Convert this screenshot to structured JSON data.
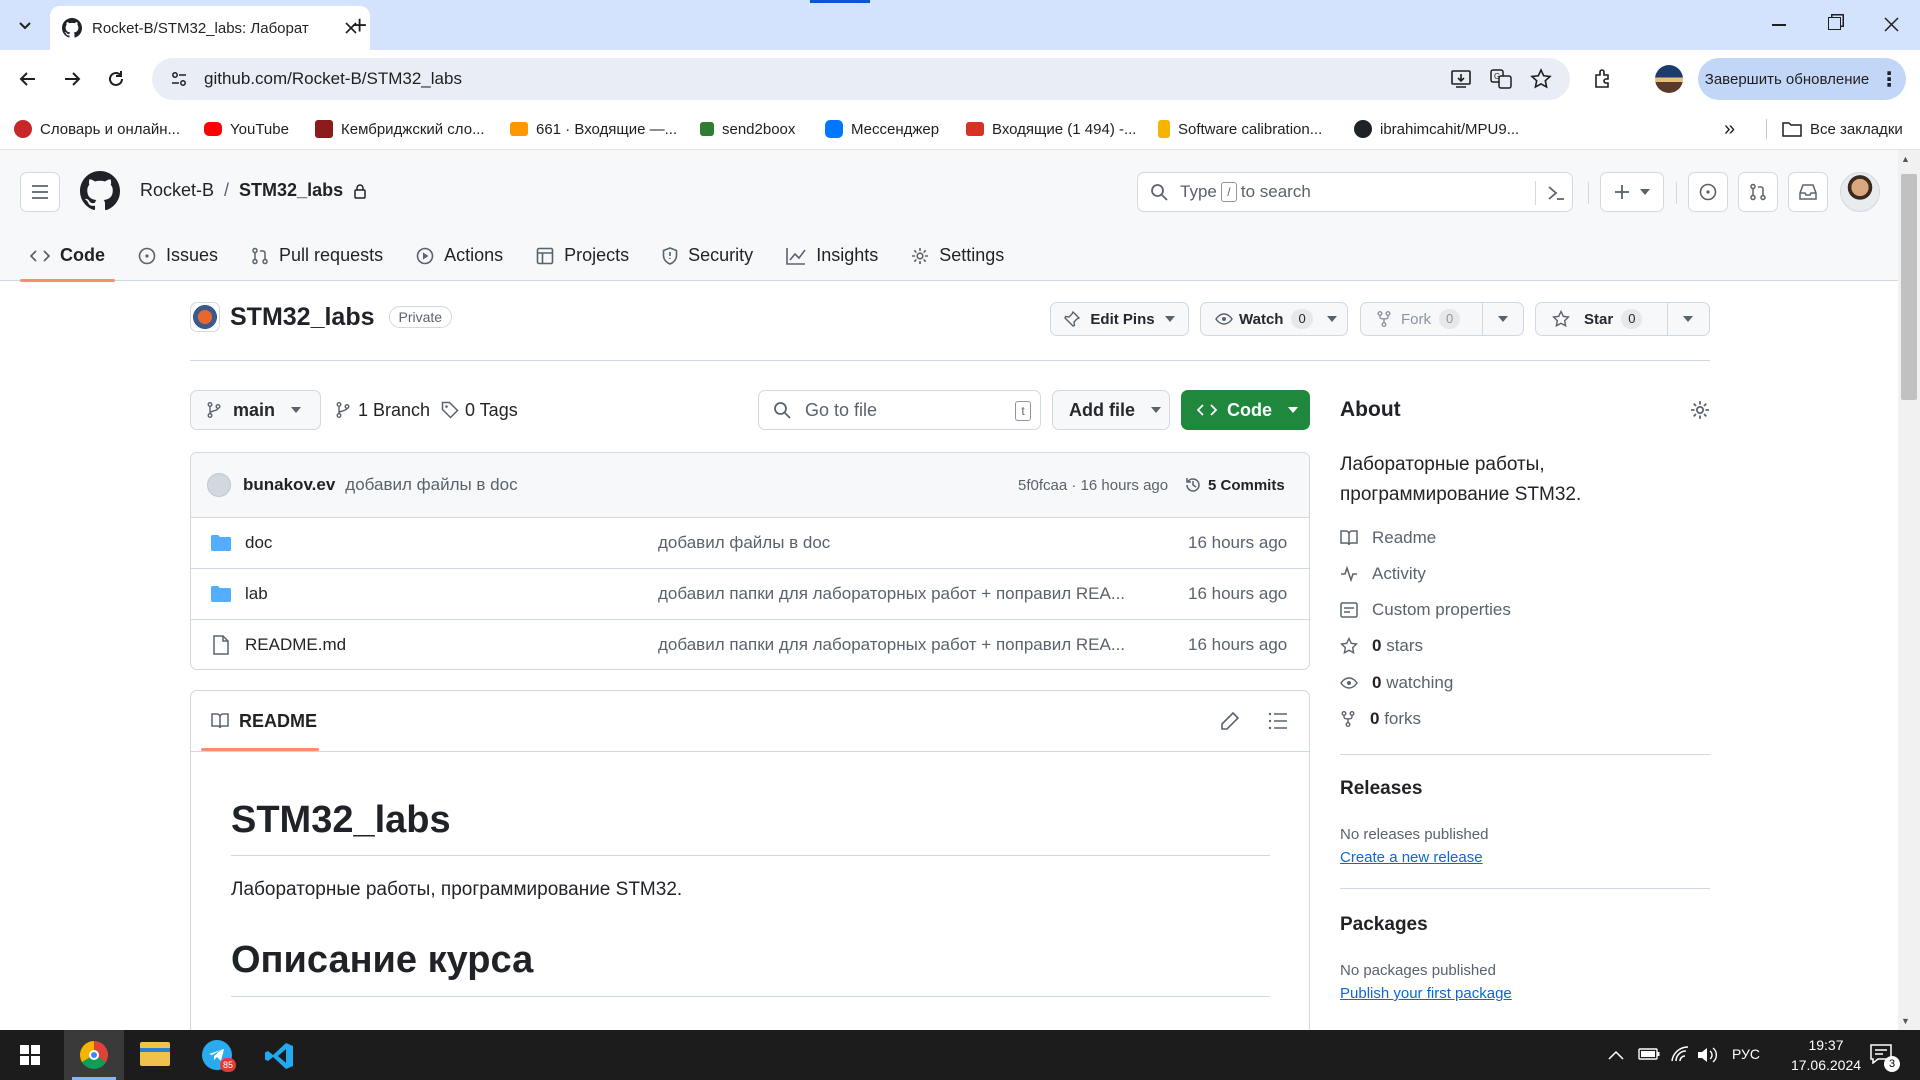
{
  "browser": {
    "tab_title": "Rocket-B/STM32_labs: Лаборат",
    "new_tab": "+",
    "url": "github.com/Rocket-B/STM32_labs",
    "update_button": "Завершить обновление",
    "more": "⋮"
  },
  "bookmarks": {
    "items": [
      {
        "label": "Словарь и онлайн...",
        "color": "#c62828"
      },
      {
        "label": "YouTube",
        "color": "#ff0000"
      },
      {
        "label": "Кембриджский сло...",
        "color": "#8b1a1a"
      },
      {
        "label": "661 · Входящие —...",
        "color": "#ff9800"
      },
      {
        "label": "send2boox",
        "color": "#2e7d32"
      },
      {
        "label": "Мессенджер",
        "color": "#0077ff"
      },
      {
        "label": "Входящие (1 494) -...",
        "color": "#d93025"
      },
      {
        "label": "Software calibration...",
        "color": "#f4b400"
      },
      {
        "label": "ibrahimcahit/MPU9...",
        "color": "#1f2328"
      }
    ],
    "overflow": "»",
    "all_label": "Все закладки"
  },
  "github": {
    "owner": "Rocket-B",
    "slash": "/",
    "repo": "STM32_labs",
    "search_prefix": "Type",
    "search_key": "/",
    "search_suffix": "to search",
    "nav": [
      {
        "label": "Code",
        "icon": "code-icon"
      },
      {
        "label": "Issues",
        "icon": "issue-icon"
      },
      {
        "label": "Pull requests",
        "icon": "pr-icon"
      },
      {
        "label": "Actions",
        "icon": "play-icon"
      },
      {
        "label": "Projects",
        "icon": "table-icon"
      },
      {
        "label": "Security",
        "icon": "shield-icon"
      },
      {
        "label": "Insights",
        "icon": "graph-icon"
      },
      {
        "label": "Settings",
        "icon": "gear-icon"
      }
    ],
    "repo_title": "STM32_labs",
    "visibility": "Private",
    "edit_pins": "Edit Pins",
    "watch": "Watch",
    "watch_count": "0",
    "fork": "Fork",
    "fork_count": "0",
    "star": "Star",
    "star_count": "0"
  },
  "files": {
    "branch": "main",
    "branches": "1 Branch",
    "tags": "0 Tags",
    "goto_placeholder": "Go to file",
    "goto_key": "t",
    "add_file": "Add file",
    "code_button": "Code",
    "commit_author": "bunakov.ev",
    "commit_message": "добавил файлы в doc",
    "commit_meta": "5f0fcaa · 16 hours ago",
    "commits": "5 Commits",
    "rows": [
      {
        "name": "doc",
        "type": "folder",
        "message": "добавил файлы в doc",
        "time": "16 hours ago"
      },
      {
        "name": "lab",
        "type": "folder",
        "message": "добавил папки для лабораторных работ + поправил REA...",
        "time": "16 hours ago"
      },
      {
        "name": "README.md",
        "type": "file",
        "message": "добавил папки для лабораторных работ + поправил REA...",
        "time": "16 hours ago"
      }
    ]
  },
  "readme": {
    "tab": "README",
    "h1": "STM32_labs",
    "paragraph": "Лабораторные работы, программирование STM32.",
    "h2": "Описание курса"
  },
  "about": {
    "title": "About",
    "description_line1": "Лабораторные работы,",
    "description_line2": "программирование STM32.",
    "links": [
      {
        "label": "Readme",
        "icon": "book-icon"
      },
      {
        "label": "Activity",
        "icon": "pulse-icon"
      },
      {
        "label": "Custom properties",
        "icon": "note-icon"
      }
    ],
    "stats": [
      {
        "count": "0",
        "label": "stars",
        "icon": "star-icon"
      },
      {
        "count": "0",
        "label": "watching",
        "icon": "eye-icon"
      },
      {
        "count": "0",
        "label": "forks",
        "icon": "fork-icon"
      }
    ],
    "releases_title": "Releases",
    "releases_none": "No releases published",
    "releases_link": "Create a new release",
    "packages_title": "Packages",
    "packages_none": "No packages published",
    "packages_link": "Publish your first package"
  },
  "taskbar": {
    "lang": "РУС",
    "time": "19:37",
    "date": "17.06.2024",
    "telegram_badge": "85",
    "notif_count": "3"
  }
}
